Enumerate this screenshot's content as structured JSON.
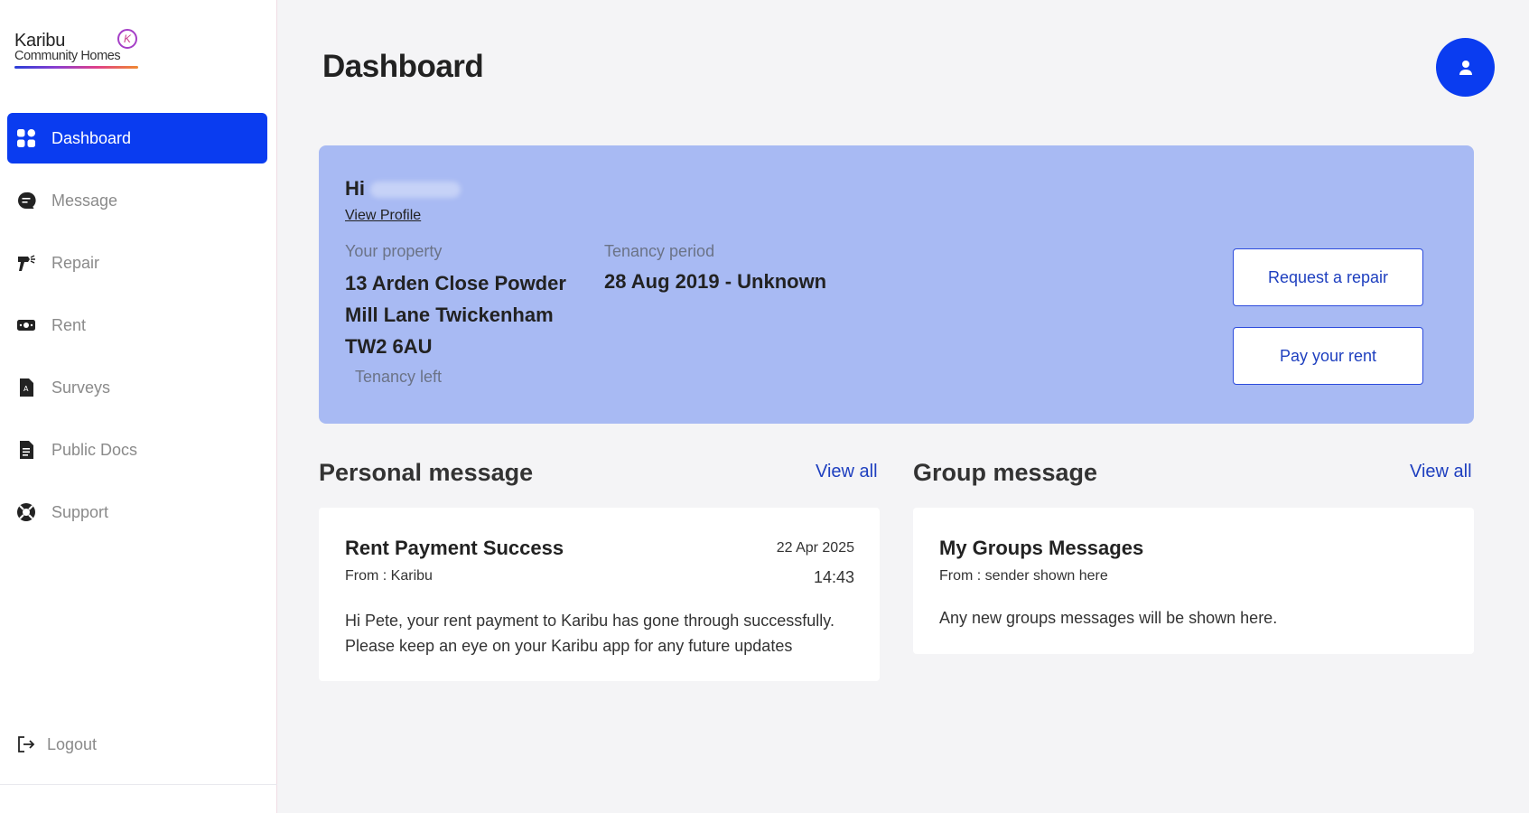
{
  "brand": {
    "name": "Karibu",
    "subtitle": "Community Homes",
    "mark": "K"
  },
  "sidebar": {
    "items": [
      {
        "label": "Dashboard",
        "icon": "grid-icon",
        "active": true
      },
      {
        "label": "Message",
        "icon": "chat-icon",
        "active": false
      },
      {
        "label": "Repair",
        "icon": "drill-icon",
        "active": false
      },
      {
        "label": "Rent",
        "icon": "money-icon",
        "active": false
      },
      {
        "label": "Surveys",
        "icon": "survey-icon",
        "active": false
      },
      {
        "label": "Public Docs",
        "icon": "document-icon",
        "active": false
      },
      {
        "label": "Support",
        "icon": "lifebuoy-icon",
        "active": false
      }
    ],
    "logout_label": "Logout"
  },
  "header": {
    "title": "Dashboard"
  },
  "hero": {
    "greeting": "Hi",
    "view_profile": "View Profile",
    "property_label": "Your property",
    "property_value": "13 Arden Close Powder Mill Lane Twickenham TW2 6AU",
    "tenancy_left_label": "Tenancy left",
    "period_label": "Tenancy period",
    "period_value": "28 Aug 2019 - Unknown",
    "request_repair": "Request a repair",
    "pay_rent": "Pay your rent"
  },
  "personal": {
    "title": "Personal message",
    "view_all": "View all",
    "message": {
      "title": "Rent Payment Success",
      "from": "From : Karibu",
      "date": "22 Apr 2025",
      "time": "14:43",
      "body": "Hi Pete, your rent payment to Karibu has gone through successfully. Please keep an eye on your Karibu app for any future updates"
    }
  },
  "group": {
    "title": "Group message",
    "view_all": "View all",
    "message": {
      "title": "My Groups Messages",
      "from": "From : sender shown here",
      "body": "Any new groups messages will be shown here."
    }
  },
  "colors": {
    "accent": "#0a3cf0",
    "hero_bg": "#a8baf3",
    "link": "#1e3fbf"
  }
}
